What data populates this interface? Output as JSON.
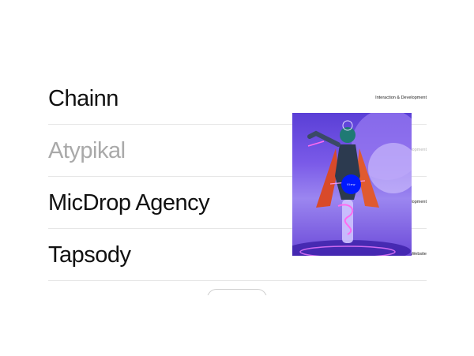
{
  "projects": [
    {
      "name": "Chainn",
      "tag": "Interaction & Development",
      "state": "normal"
    },
    {
      "name": "Atypikal",
      "tag": "Interaction & Development",
      "state": "dim"
    },
    {
      "name": "MicDrop Agency",
      "tag": "Interaction & Development",
      "state": "normal"
    },
    {
      "name": "Tapsody",
      "tag": "Website",
      "state": "normal"
    }
  ],
  "preview": {
    "view_label": "View",
    "view_color": "#0019ff"
  },
  "more_button": {
    "label": ""
  }
}
